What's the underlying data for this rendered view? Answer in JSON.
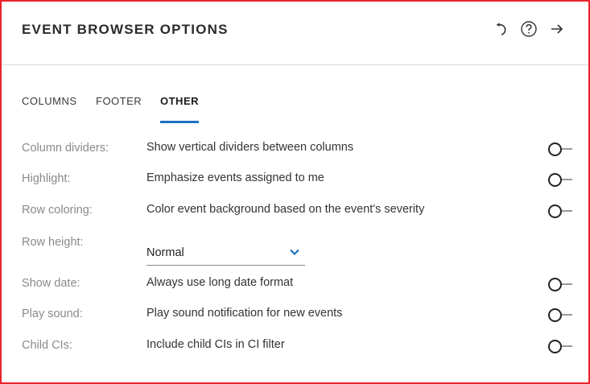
{
  "header": {
    "title": "EVENT BROWSER OPTIONS",
    "icons": [
      "undo-icon",
      "help-icon",
      "arrow-right-icon"
    ]
  },
  "tabs": [
    {
      "label": "COLUMNS",
      "active": false
    },
    {
      "label": "FOOTER",
      "active": false
    },
    {
      "label": "OTHER",
      "active": true
    }
  ],
  "colors": {
    "accent": "#1f6fc5",
    "border": "#e8232a",
    "label": "#8a8a8a"
  },
  "options": {
    "column_dividers": {
      "label": "Column dividers:",
      "description": "Show vertical dividers between columns",
      "enabled": false
    },
    "highlight": {
      "label": "Highlight:",
      "description": "Emphasize events assigned to me",
      "enabled": false
    },
    "row_coloring": {
      "label": "Row coloring:",
      "description": "Color event background based on the event's severity",
      "enabled": false
    },
    "row_height": {
      "label": "Row height:",
      "value": "Normal"
    },
    "show_date": {
      "label": "Show date:",
      "description": "Always use long date format",
      "enabled": false
    },
    "play_sound": {
      "label": "Play sound:",
      "description": "Play sound notification for new events",
      "enabled": false
    },
    "child_cis": {
      "label": "Child CIs:",
      "description": "Include child CIs in CI filter",
      "enabled": false
    }
  }
}
